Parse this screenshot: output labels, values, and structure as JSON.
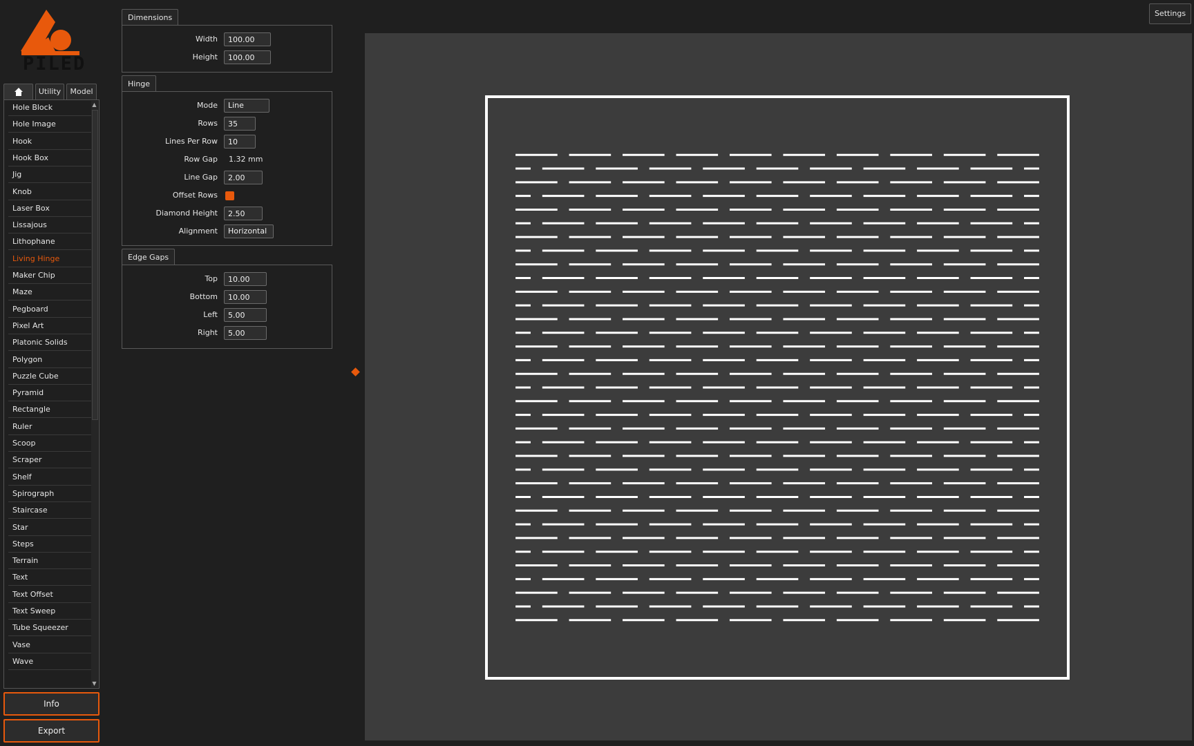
{
  "app": {
    "logo_text": "PILED",
    "accent_color": "#e8590c",
    "settings_label": "Settings"
  },
  "tabs": [
    {
      "label": "",
      "icon": "home-icon"
    },
    {
      "label": "Utility"
    },
    {
      "label": "Model"
    }
  ],
  "model_list": {
    "selected": "Living Hinge",
    "items": [
      "Hole Block",
      "Hole Image",
      "Hook",
      "Hook Box",
      "Jig",
      "Knob",
      "Laser Box",
      "Lissajous",
      "Lithophane",
      "Living Hinge",
      "Maker Chip",
      "Maze",
      "Pegboard",
      "Pixel Art",
      "Platonic Solids",
      "Polygon",
      "Puzzle Cube",
      "Pyramid",
      "Rectangle",
      "Ruler",
      "Scoop",
      "Scraper",
      "Shelf",
      "Spirograph",
      "Staircase",
      "Star",
      "Steps",
      "Terrain",
      "Text",
      "Text Offset",
      "Text Sweep",
      "Tube Squeezer",
      "Vase",
      "Wave"
    ]
  },
  "buttons": {
    "info": "Info",
    "export": "Export"
  },
  "dimensions": {
    "title": "Dimensions",
    "width_label": "Width",
    "width": "100.00",
    "height_label": "Height",
    "height": "100.00"
  },
  "hinge": {
    "title": "Hinge",
    "mode_label": "Mode",
    "mode": "Line",
    "rows_label": "Rows",
    "rows": "35",
    "lines_per_row_label": "Lines Per Row",
    "lines_per_row": "10",
    "row_gap_label": "Row Gap",
    "row_gap": "1.32 mm",
    "line_gap_label": "Line Gap",
    "line_gap": "2.00",
    "offset_rows_label": "Offset Rows",
    "offset_rows": true,
    "diamond_height_label": "Diamond Height",
    "diamond_height": "2.50",
    "alignment_label": "Alignment",
    "alignment": "Horizontal"
  },
  "edge_gaps": {
    "title": "Edge Gaps",
    "top_label": "Top",
    "top": "10.00",
    "bottom_label": "Bottom",
    "bottom": "10.00",
    "left_label": "Left",
    "left": "5.00",
    "right_label": "Right",
    "right": "5.00"
  }
}
